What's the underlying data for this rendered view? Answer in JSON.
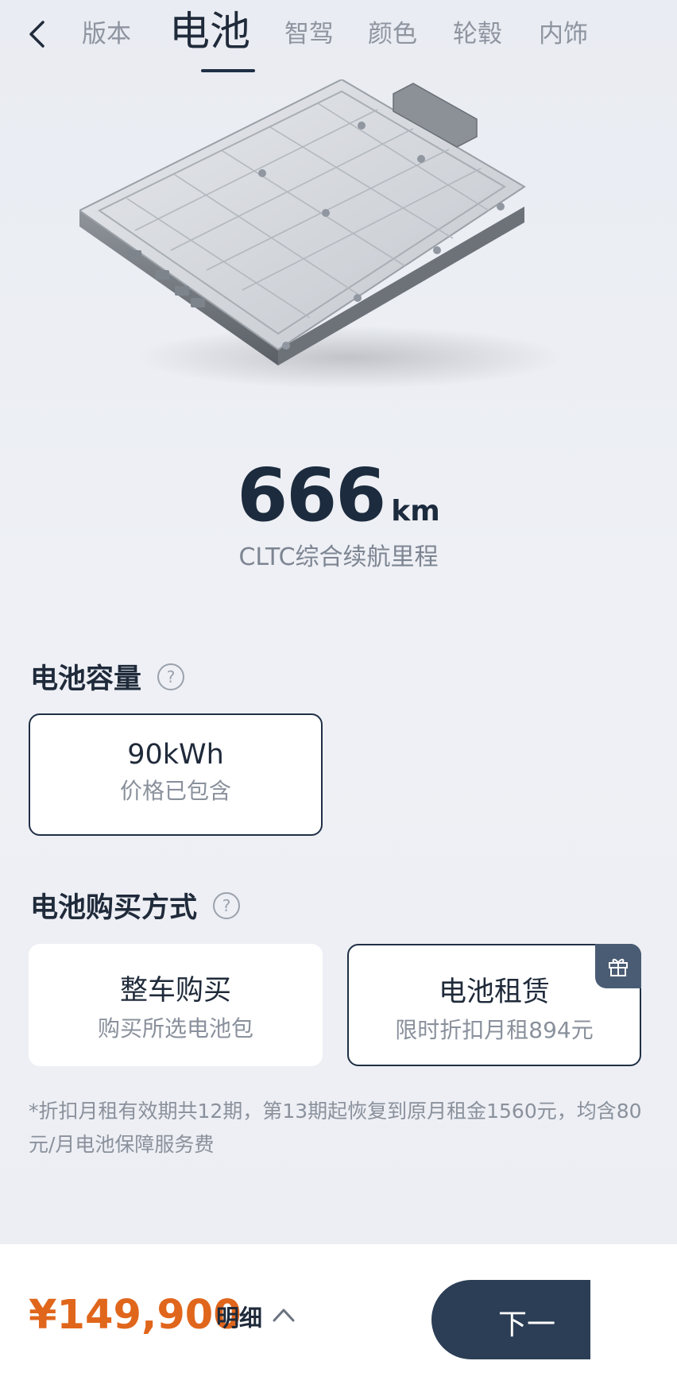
{
  "nav": {
    "tabs": [
      {
        "label": "版本",
        "active": false
      },
      {
        "label": "电池",
        "active": true
      },
      {
        "label": "智驾",
        "active": false
      },
      {
        "label": "颜色",
        "active": false
      },
      {
        "label": "轮毂",
        "active": false
      },
      {
        "label": "内饰",
        "active": false
      }
    ]
  },
  "range": {
    "value": "666",
    "unit": "km",
    "caption": "CLTC综合续航里程"
  },
  "capacity": {
    "title": "电池容量",
    "options": [
      {
        "label": "90kWh",
        "sub": "价格已包含",
        "selected": true
      }
    ]
  },
  "purchase": {
    "title": "电池购买方式",
    "options": [
      {
        "label": "整车购买",
        "sub": "购买所选电池包",
        "selected": false
      },
      {
        "label": "电池租赁",
        "sub": "限时折扣月租894元",
        "selected": true,
        "icon": "gift-icon"
      }
    ],
    "note": "*折扣月租有效期共12期，第13期起恢复到原月租金1560元，均含80元/月电池保障服务费"
  },
  "footer": {
    "price": "¥149,900",
    "detail_label": "明细",
    "next_label": "下一"
  },
  "colors": {
    "accent": "#1f2f45",
    "price": "#e0661c",
    "button": "#2b3e55"
  }
}
